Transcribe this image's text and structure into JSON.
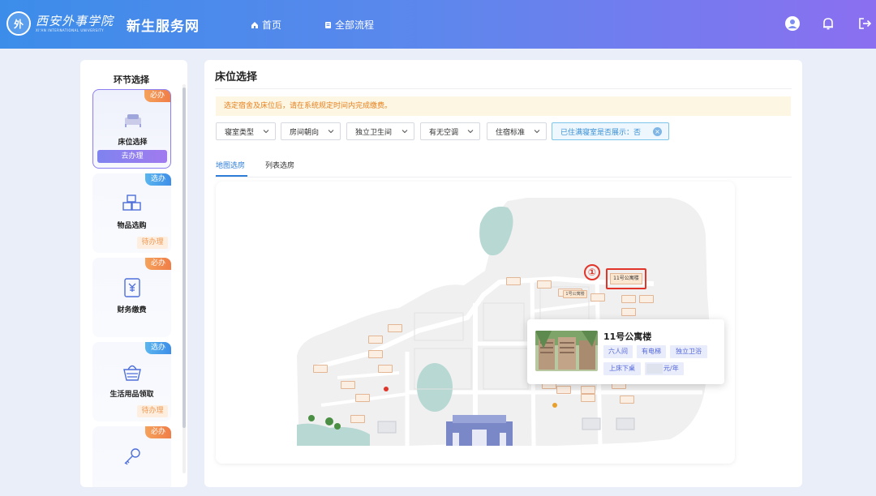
{
  "header": {
    "logo_cn": "西安外事学院",
    "logo_en": "XI'AN INTERNATIONAL UNIVERSITY",
    "site_title": "新生服务网",
    "nav": [
      {
        "label": "首页",
        "icon": "home-icon"
      },
      {
        "label": "全部流程",
        "icon": "file-icon"
      }
    ],
    "icons": [
      "user-avatar-icon",
      "bell-icon",
      "logout-icon"
    ]
  },
  "sidebar": {
    "title": "环节选择",
    "steps": [
      {
        "label": "床位选择",
        "badge": "必办",
        "action": "去办理",
        "icon": "bed-icon",
        "active": true
      },
      {
        "label": "物品选购",
        "badge": "选办",
        "status": "待办理",
        "icon": "boxes-icon"
      },
      {
        "label": "财务缴费",
        "badge": "必办",
        "icon": "payment-icon"
      },
      {
        "label": "生活用品领取",
        "badge": "选办",
        "status": "待办理",
        "icon": "basket-icon"
      },
      {
        "label": "",
        "badge": "必办",
        "icon": "key-icon"
      }
    ]
  },
  "main": {
    "title": "床位选择",
    "notice": "选定宿舍及床位后，请在系统规定时间内完成缴费。",
    "filters": [
      {
        "label": "寝室类型"
      },
      {
        "label": "房间朝向"
      },
      {
        "label": "独立卫生间"
      },
      {
        "label": "有无空调"
      },
      {
        "label": "住宿标准"
      }
    ],
    "show_full_filter": "已住满寝室是否展示：否",
    "tabs": [
      "地图选房",
      "列表选房"
    ],
    "active_tab": "地图选房"
  },
  "map": {
    "popup": {
      "title": "11号公寓楼",
      "features": [
        "六人间",
        "有电梯",
        "独立卫浴",
        "上床下桌"
      ],
      "price_unit": "元/年"
    },
    "marker_number": "①",
    "highlight_label": "11号公寓楼",
    "nearby_label": "1号公寓楼"
  },
  "colors": {
    "header_start": "#3c8dea",
    "header_end": "#8b6ff0",
    "accent_blue": "#2f7fd9",
    "required_badge": "#ef7d47",
    "optional_badge": "#3e8ee8",
    "notice_text": "#e7811e",
    "highlight_red": "#e1352a"
  }
}
